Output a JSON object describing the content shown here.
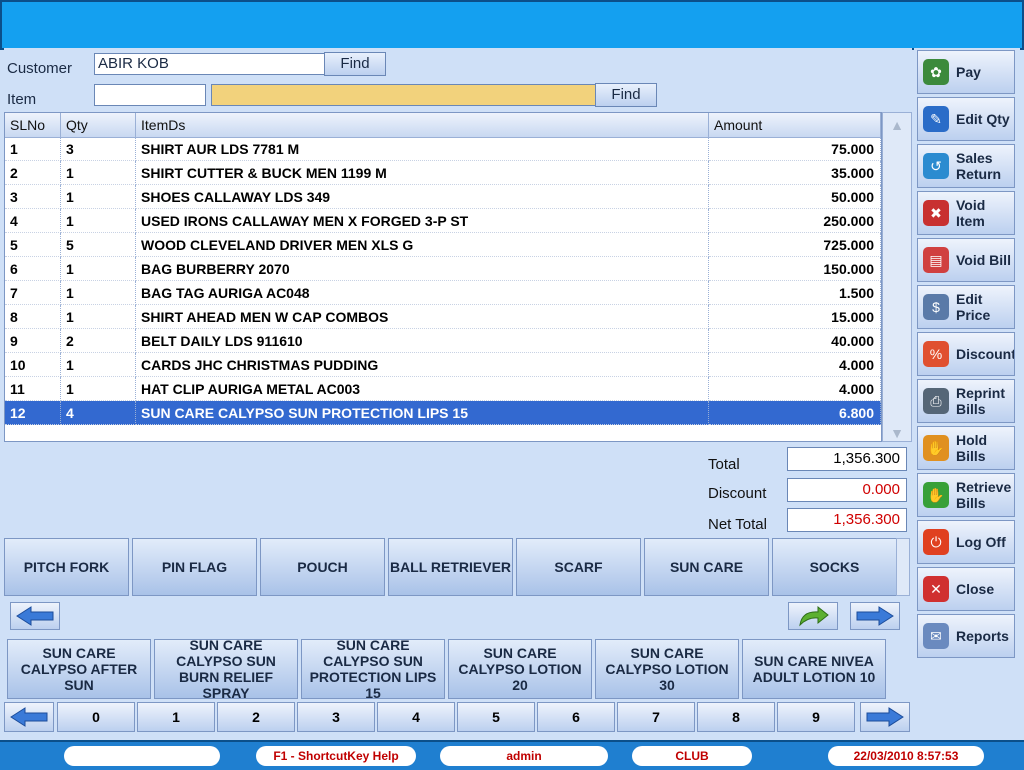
{
  "form": {
    "customer_label": "Customer",
    "customer_value": "ABIR  KOB",
    "find_customer": "Find",
    "item_label": "Item",
    "item_code": "",
    "item_search": "",
    "find_item": "Find"
  },
  "grid": {
    "headers": [
      "SLNo",
      "Qty",
      "ItemDs",
      "Amount"
    ],
    "rows": [
      {
        "sl": "1",
        "qty": "3",
        "item": "SHIRT  AUR LDS 7781 M",
        "amount": "75.000"
      },
      {
        "sl": "2",
        "qty": "1",
        "item": "SHIRT CUTTER & BUCK MEN 1199 M",
        "amount": "35.000"
      },
      {
        "sl": "3",
        "qty": "1",
        "item": "SHOES CALLAWAY LDS 349",
        "amount": "50.000"
      },
      {
        "sl": "4",
        "qty": "1",
        "item": "USED IRONS CALLAWAY MEN X FORGED 3-P ST",
        "amount": "250.000"
      },
      {
        "sl": "5",
        "qty": "5",
        "item": "WOOD CLEVELAND DRIVER MEN XLS G",
        "amount": "725.000"
      },
      {
        "sl": "6",
        "qty": "1",
        "item": "BAG BURBERRY 2070",
        "amount": "150.000"
      },
      {
        "sl": "7",
        "qty": "1",
        "item": "BAG TAG AURIGA AC048",
        "amount": "1.500"
      },
      {
        "sl": "8",
        "qty": "1",
        "item": "SHIRT AHEAD MEN W CAP COMBOS",
        "amount": "15.000"
      },
      {
        "sl": "9",
        "qty": "2",
        "item": "BELT DAILY LDS 911610",
        "amount": "40.000"
      },
      {
        "sl": "10",
        "qty": "1",
        "item": "CARDS JHC CHRISTMAS PUDDING",
        "amount": "4.000"
      },
      {
        "sl": "11",
        "qty": "1",
        "item": "HAT CLIP AURIGA METAL AC003",
        "amount": "4.000"
      },
      {
        "sl": "12",
        "qty": "4",
        "item": "SUN CARE CALYPSO SUN PROTECTION LIPS 15",
        "amount": "6.800"
      }
    ],
    "selected_row": 12
  },
  "totals": {
    "total_label": "Total",
    "total_value": "1,356.300",
    "discount_label": "Discount",
    "discount_value": "0.000",
    "net_label": "Net Total",
    "net_value": "1,356.300"
  },
  "categories": [
    "PITCH FORK",
    "PIN FLAG",
    "POUCH",
    "BALL RETRIEVER",
    "SCARF",
    "SUN CARE",
    "SOCKS"
  ],
  "products": [
    "SUN CARE CALYPSO AFTER SUN",
    "SUN CARE CALYPSO SUN BURN RELIEF SPRAY",
    "SUN CARE CALYPSO SUN PROTECTION LIPS 15",
    "SUN CARE CALYPSO LOTION 20",
    "SUN CARE CALYPSO LOTION 30",
    "SUN CARE NIVEA ADULT LOTION 10"
  ],
  "digits": [
    "0",
    "1",
    "2",
    "3",
    "4",
    "5",
    "6",
    "7",
    "8",
    "9"
  ],
  "actions": [
    {
      "label": "Pay",
      "icon": "flowers-icon",
      "color": "#3c8a3c"
    },
    {
      "label": "Edit Qty",
      "icon": "edit-qty-icon",
      "color": "#2a6cc8"
    },
    {
      "label": "Sales\nReturn",
      "icon": "return-icon",
      "color": "#2b8bd0"
    },
    {
      "label": "Void\nItem",
      "icon": "void-item-icon",
      "color": "#c83030"
    },
    {
      "label": "Void Bill",
      "icon": "void-bill-icon",
      "color": "#d04040"
    },
    {
      "label": "Edit\nPrice",
      "icon": "edit-price-icon",
      "color": "#5a7aa8"
    },
    {
      "label": "Discount",
      "icon": "discount-icon",
      "color": "#e05030"
    },
    {
      "label": "Reprint\nBills",
      "icon": "printer-icon",
      "color": "#556677"
    },
    {
      "label": "Hold\nBills",
      "icon": "hold-hand-icon",
      "color": "#e09020"
    },
    {
      "label": "Retrieve\nBills",
      "icon": "retrieve-hand-icon",
      "color": "#38a038"
    },
    {
      "label": "Log Off",
      "icon": "power-icon",
      "color": "#e04020"
    },
    {
      "label": "Close",
      "icon": "close-icon",
      "color": "#d03030"
    },
    {
      "label": "Reports",
      "icon": "reports-icon",
      "color": "#6a8abf"
    }
  ],
  "status": {
    "blank": "",
    "help": "F1 - ShortcutKey Help",
    "user": "admin",
    "location": "CLUB",
    "datetime": "22/03/2010 8:57:53"
  },
  "colors": {
    "accent": "#3369d0",
    "discount_red": "#d00000",
    "top_bar": "#14a0f0"
  }
}
